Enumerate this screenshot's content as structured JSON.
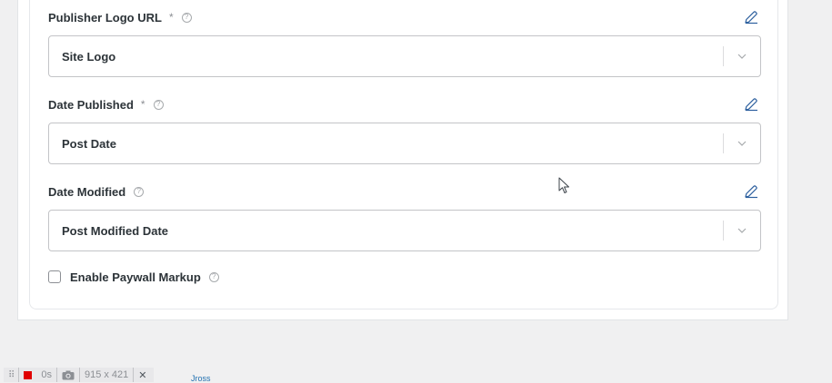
{
  "fields": [
    {
      "label": "Publisher Logo URL",
      "required": "*",
      "help": "?",
      "value": "Site Logo"
    },
    {
      "label": "Date Published",
      "required": "*",
      "help": "?",
      "value": "Post Date"
    },
    {
      "label": "Date Modified",
      "help": "?",
      "value": "Post Modified Date"
    }
  ],
  "paywall": {
    "label": "Enable Paywall Markup",
    "help": "?",
    "checked": false
  },
  "devtools": {
    "grip": "⠿",
    "timer": "0s",
    "dimensions": "915 x 421",
    "close": "✕",
    "overflow_text": "Jross"
  },
  "colors": {
    "edit_icon": "#2c5f9e",
    "record": "#e00000",
    "border": "#c3c4c7"
  }
}
